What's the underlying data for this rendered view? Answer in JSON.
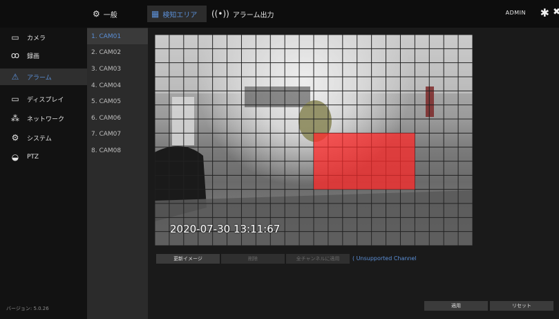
{
  "topbar": {
    "tabs": [
      {
        "label": "一般",
        "icon": "general-icon"
      },
      {
        "label": "検知エリア",
        "icon": "detect-area-icon"
      },
      {
        "label": "アラーム出力",
        "icon": "alarm-output-icon"
      }
    ],
    "user": "ADMIN"
  },
  "sidebar": {
    "items": [
      {
        "label": "カメラ",
        "icon": "camera-icon"
      },
      {
        "label": "録画",
        "icon": "record-icon"
      },
      {
        "label": "アラーム",
        "icon": "alarm-icon"
      },
      {
        "label": "ディスプレイ",
        "icon": "display-icon"
      },
      {
        "label": "ネットワーク",
        "icon": "network-icon"
      },
      {
        "label": "システム",
        "icon": "system-icon"
      },
      {
        "label": "PTZ",
        "icon": "ptz-icon"
      }
    ],
    "version": "バージョン: 5.0.26"
  },
  "cameras": [
    "1. CAM01",
    "2. CAM02",
    "3. CAM03",
    "4. CAM04",
    "5. CAM05",
    "6. CAM06",
    "7. CAM07",
    "8. CAM08"
  ],
  "video": {
    "timestamp": "2020-07-30 13:11:67",
    "grid_cols": 22,
    "grid_rows": 15,
    "detection_cells": {
      "col_start": 11,
      "col_end": 17,
      "row_start": 7,
      "row_end": 10
    },
    "detection_color": "#ff2a2a"
  },
  "actions": {
    "update_image": "更新イメージ",
    "delete": "削除",
    "apply_all": "全チャンネルに適用",
    "unsupported": "( Unsupported Channel",
    "apply": "適用",
    "reset": "リセット"
  },
  "colors": {
    "accent": "#5b8fd6"
  }
}
